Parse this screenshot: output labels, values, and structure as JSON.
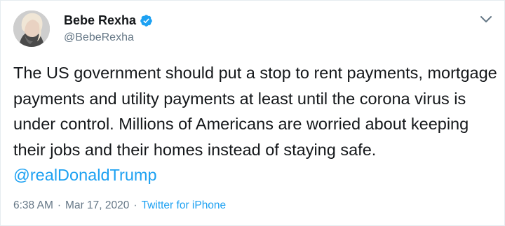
{
  "user": {
    "display_name": "Bebe Rexha",
    "handle": "@BebeRexha",
    "verified": true,
    "avatar_icon": "profile-photo-avatar"
  },
  "tweet": {
    "text_before_mention": "The US government should put a stop to rent payments, mortgage payments and utility payments at least until the corona virus is under control. Millions of Americans are worried about keeping their jobs and their homes instead of staying safe. ",
    "mention": "@realDonaldTrump"
  },
  "meta": {
    "time": "6:38 AM",
    "separator": "·",
    "date": "Mar 17, 2020",
    "source": "Twitter for iPhone"
  },
  "colors": {
    "link": "#1da1f2",
    "secondary_text": "#657786",
    "primary_text": "#14171a",
    "border": "#e6ecf0"
  },
  "icons": {
    "verified": "verified-badge-icon",
    "menu": "chevron-down-icon"
  }
}
